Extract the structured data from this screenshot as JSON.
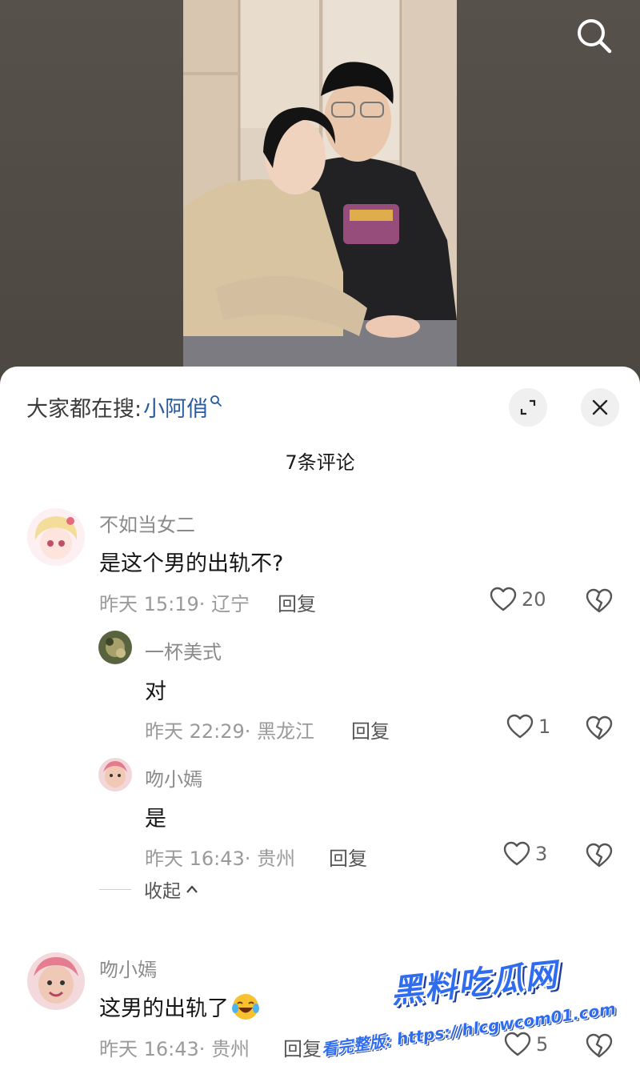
{
  "header": {
    "hot_search_prefix": "大家都在搜:",
    "hot_search_keyword": "小阿俏"
  },
  "comments_count_label": "7条评论",
  "comments": [
    {
      "user": "不如当女二",
      "text": "是这个男的出轨不?",
      "time": "昨天 15:19",
      "location": "辽宁",
      "reply": "回复",
      "likes": "20"
    },
    {
      "user": "吻小嫣",
      "text": "这男的出轨了",
      "time": "昨天 16:43",
      "location": "贵州",
      "reply": "回复",
      "likes": "5"
    }
  ],
  "replies": [
    {
      "user": "一杯美式",
      "text": "对",
      "time": "昨天 22:29",
      "location": "黑龙江",
      "reply": "回复",
      "likes": "1"
    },
    {
      "user": "吻小嫣",
      "text": "是",
      "time": "昨天 16:43",
      "location": "贵州",
      "reply": "回复",
      "likes": "3"
    }
  ],
  "collapse_label": "收起",
  "watermark": {
    "title": "黑料吃瓜网",
    "url": "看完整版: https://hlcgwcom01.com"
  },
  "colors": {
    "keyword": "#2a5b9e",
    "watermark": "#2f6cf0"
  }
}
